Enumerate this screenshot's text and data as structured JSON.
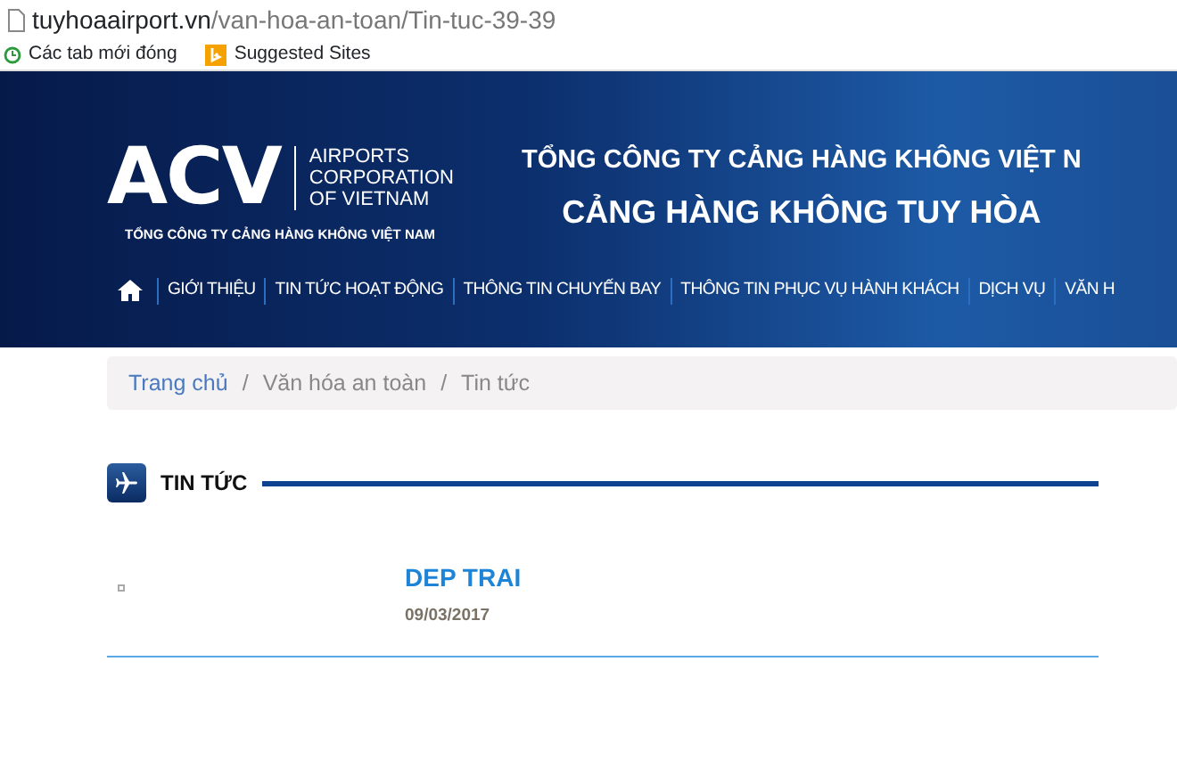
{
  "browser": {
    "address": {
      "host": "tuyhoaairport.vn",
      "path": "/van-hoa-an-toan/Tin-tuc-39-39"
    },
    "bookmarks": [
      {
        "kind": "history",
        "label": "Các tab mới đóng"
      },
      {
        "kind": "bing",
        "label": "Suggested Sites"
      }
    ]
  },
  "header": {
    "logo": {
      "mark": "ACV",
      "lines": [
        "AIRPORTS",
        "CORPORATION",
        "OF VIETNAM"
      ],
      "tagline": "TỔNG CÔNG TY CẢNG HÀNG KHÔNG VIỆT NAM"
    },
    "titles": [
      "TỔNG CÔNG TY CẢNG HÀNG KHÔNG VIỆT N",
      "CẢNG HÀNG KHÔNG TUY HÒA"
    ],
    "nav": [
      "GIỚI THIỆU",
      "TIN TỨC HOẠT ĐỘNG",
      "THÔNG TIN CHUYẾN BAY",
      "THÔNG TIN PHỤC VỤ HÀNH KHÁCH",
      "DỊCH VỤ",
      "VĂN H"
    ]
  },
  "breadcrumb_separator": "/",
  "breadcrumb": [
    {
      "label": "Trang chủ",
      "link": true
    },
    {
      "label": "Văn hóa an toàn",
      "link": false
    },
    {
      "label": "Tin tức",
      "link": false
    }
  ],
  "section": {
    "title": "TIN TỨC"
  },
  "articles": [
    {
      "title": "DEP TRAI",
      "date": "09/03/2017"
    }
  ]
}
